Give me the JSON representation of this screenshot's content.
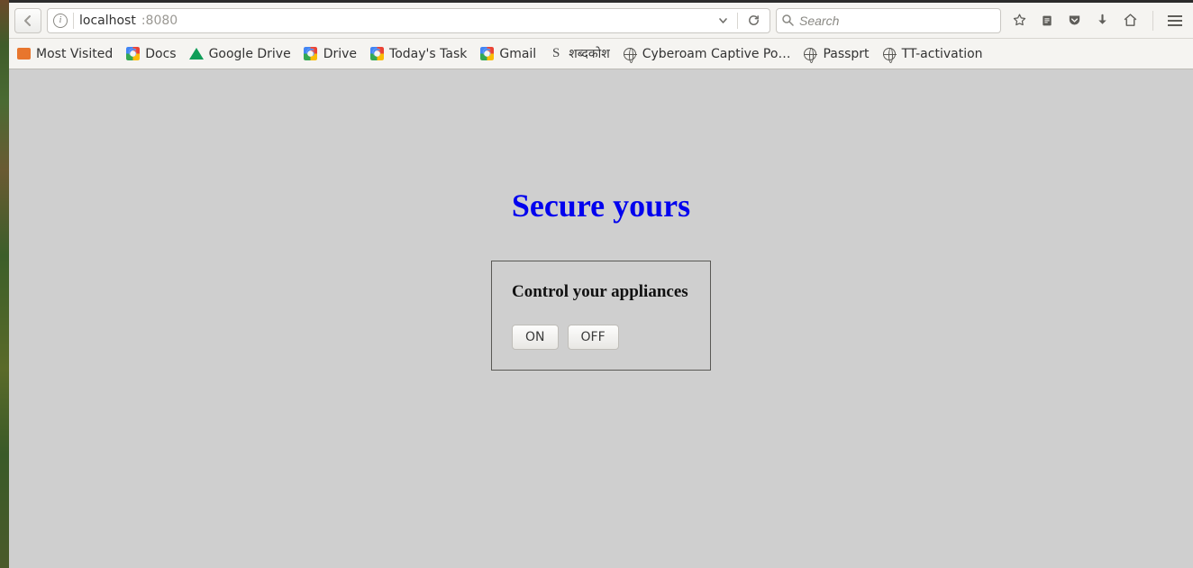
{
  "url": {
    "host": "localhost",
    "port": ":8080"
  },
  "search": {
    "placeholder": "Search"
  },
  "bookmarks": [
    {
      "label": "Most Visited",
      "icon": "mv"
    },
    {
      "label": "Docs",
      "icon": "g"
    },
    {
      "label": "Google Drive",
      "icon": "drive"
    },
    {
      "label": "Drive",
      "icon": "g"
    },
    {
      "label": "Today's Task",
      "icon": "g"
    },
    {
      "label": "Gmail",
      "icon": "g"
    },
    {
      "label": "शब्दकोश",
      "icon": "s"
    },
    {
      "label": "Cyberoam Captive Po…",
      "icon": "globe"
    },
    {
      "label": "Passprt",
      "icon": "globe"
    },
    {
      "label": "TT-activation",
      "icon": "globe"
    }
  ],
  "page": {
    "title": "Secure yours",
    "card_heading": "Control your appliances",
    "on_label": "ON",
    "off_label": "OFF"
  }
}
